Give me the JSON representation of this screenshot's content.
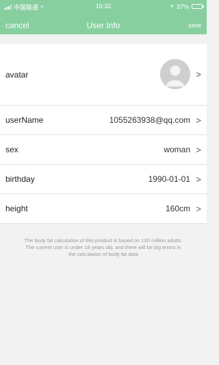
{
  "status": {
    "carrier": "中国联通",
    "time": "15:32",
    "battery": "37%"
  },
  "nav": {
    "cancel_label": "cancel",
    "title": "User Info",
    "save_label": "save"
  },
  "fields": {
    "avatar_label": "avatar",
    "username_label": "userName",
    "username_value": "1055263938@qq.com",
    "sex_label": "sex",
    "sex_value": "woman",
    "birthday_label": "birthday",
    "birthday_value": "1990-01-01",
    "height_label": "height",
    "height_value": "160cm"
  },
  "chevron": ">",
  "note": "The body fat calculation of this product is based on 100 million adults. The current user is under 18 years old, and there will be big errors in the calculation of body fat data",
  "colors": {
    "header": "#88cfa0",
    "background": "#f2f2f2"
  },
  "icons": {
    "signal": "signal-icon",
    "wifi": "wifi-icon",
    "location": "location-icon",
    "battery": "battery-icon",
    "avatar": "user-silhouette-icon"
  }
}
